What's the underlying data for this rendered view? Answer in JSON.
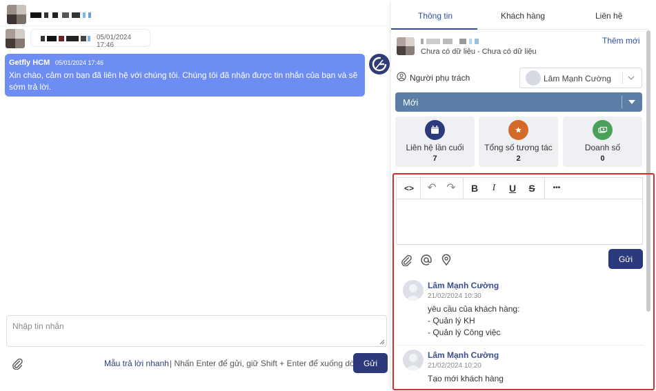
{
  "chat": {
    "messages": [
      {
        "type": "incoming",
        "time": "05/01/2024 17:46"
      },
      {
        "type": "outgoing",
        "sender": "Getfly HCM",
        "time": "05/01/2024 17:46",
        "text": "Xin chào, cảm ơn bạn đã liên hệ với chúng tôi. Chúng tôi đã nhận được tin nhắn của bạn và sẽ sớm trả lời."
      }
    ],
    "compose": {
      "placeholder": "Nhập tin nhắn"
    },
    "templates_link": "Mẫu trả lời nhanh",
    "hint": "| Nhấn Enter để gửi, giữ Shift + Enter để xuống dòng",
    "send_label": "Gửi",
    "bot_avatar_icon": "getfly-logo-icon"
  },
  "sidebar": {
    "tabs": [
      {
        "label": "Thông tin",
        "active": true
      },
      {
        "label": "Khách hàng",
        "active": false
      },
      {
        "label": "Liên hệ",
        "active": false
      }
    ],
    "contact": {
      "subtitle": "Chưa có dữ liệu - Chưa có dữ liệu",
      "add_new_label": "Thêm mới"
    },
    "owner": {
      "label": "Người phụ trách",
      "value": "Lâm Mạnh Cường",
      "icon": "user-circle-icon"
    },
    "status": {
      "value": "Mới"
    },
    "stats": [
      {
        "label": "Liên hệ lần cuối",
        "value": "7",
        "icon": "calendar-icon",
        "color": "#2b3a7a"
      },
      {
        "label": "Tổng số tương tác",
        "value": "2",
        "icon": "star-icon",
        "color": "#d46a2a"
      },
      {
        "label": "Doanh số",
        "value": "0",
        "icon": "money-icon",
        "color": "#4aa25a"
      }
    ],
    "editor": {
      "toolbar": [
        {
          "name": "code-view-icon",
          "glyph": "<>"
        },
        {
          "name": "undo-icon",
          "glyph": "↶"
        },
        {
          "name": "redo-icon",
          "glyph": "↷"
        },
        {
          "name": "bold-icon",
          "glyph": "B"
        },
        {
          "name": "italic-icon",
          "glyph": "I"
        },
        {
          "name": "underline-icon",
          "glyph": "U"
        },
        {
          "name": "strikethrough-icon",
          "glyph": "S"
        },
        {
          "name": "more-icon",
          "glyph": "•••"
        }
      ],
      "send_label": "Gửi",
      "tools": [
        "attachment-icon",
        "mention-icon",
        "location-icon"
      ]
    },
    "notes": [
      {
        "author": "Lâm Mạnh Cường",
        "date": "21/02/2024 10:30",
        "lines": [
          "yêu cầu của khách hàng:",
          "- Quản lý KH",
          "- Quản lý Công việc"
        ]
      },
      {
        "author": "Lâm Mạnh Cường",
        "date": "21/02/2024 10:20",
        "lines": [
          "Tạo mới khách hàng"
        ]
      }
    ],
    "highlight_color": "#d62b2b"
  }
}
